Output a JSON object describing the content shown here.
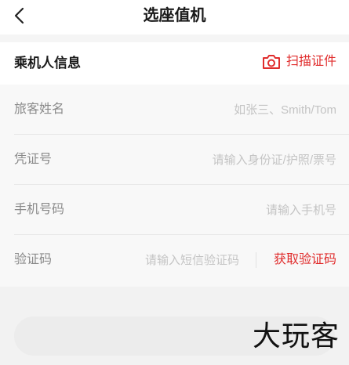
{
  "header": {
    "back_icon": "chevron-left-icon",
    "title": "选座值机"
  },
  "passenger_section": {
    "title": "乘机人信息",
    "scan": {
      "icon": "camera-icon",
      "label": "扫描证件",
      "color": "#e02c2c"
    }
  },
  "form": {
    "name": {
      "label": "旅客姓名",
      "value": "",
      "placeholder": "如张三、Smith/Tom"
    },
    "id_number": {
      "label": "凭证号",
      "value": "",
      "placeholder": "请输入身份证/护照/票号"
    },
    "phone": {
      "label": "手机号码",
      "value": "",
      "placeholder": "请输入手机号"
    },
    "verification": {
      "label": "验证码",
      "value": "",
      "placeholder": "请输入短信验证码",
      "get_code_label": "获取验证码"
    }
  },
  "watermark": {
    "text": "大玩客"
  },
  "colors": {
    "accent": "#e02c2c",
    "label": "#8a8a8a",
    "placeholder": "#c4c4c4",
    "background": "#f8f8f8"
  }
}
